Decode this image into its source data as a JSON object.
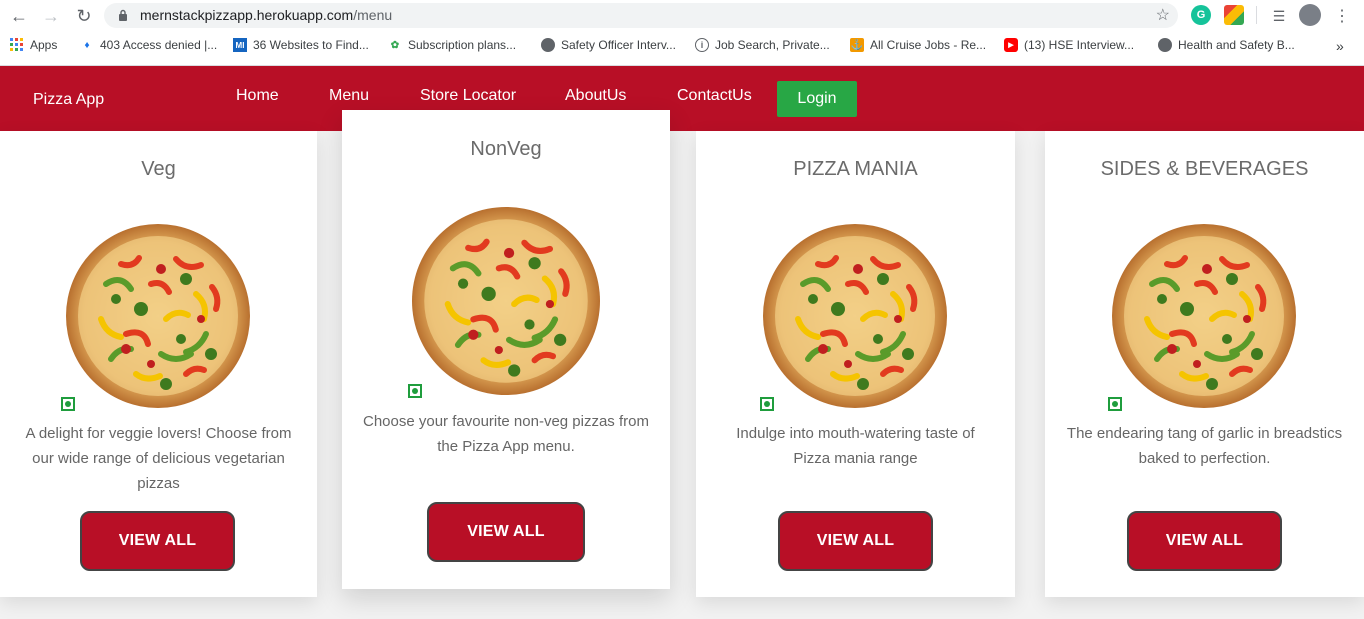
{
  "browser": {
    "url_host": "mernstackpizzapp.herokuapp.com",
    "url_path": "/menu",
    "bookmarks": [
      {
        "label": "Apps",
        "icon": "apps-grid-icon"
      },
      {
        "label": "403 Access denied |...",
        "icon": "flame-icon"
      },
      {
        "label": "36 Websites to Find...",
        "icon": "mi-logo-icon"
      },
      {
        "label": "Subscription plans...",
        "icon": "leaf-icon"
      },
      {
        "label": "Safety Officer Interv...",
        "icon": "globe-icon"
      },
      {
        "label": "Job Search, Private...",
        "icon": "info-icon"
      },
      {
        "label": "All Cruise Jobs - Re...",
        "icon": "anchor-icon"
      },
      {
        "label": "(13) HSE Interview...",
        "icon": "youtube-icon"
      },
      {
        "label": "Health and Safety B...",
        "icon": "globe-icon"
      }
    ]
  },
  "app": {
    "brand": "Pizza App",
    "nav": [
      "Home",
      "Menu",
      "Store Locator",
      "AboutUs",
      "ContactUs"
    ],
    "login_label": "Login",
    "accent": "#b80f26",
    "login_color": "#28a745"
  },
  "cards": [
    {
      "title": "Veg",
      "description": "A delight for veggie lovers! Choose from our wide range of delicious vegetarian pizzas",
      "button": "VIEW ALL"
    },
    {
      "title": "NonVeg",
      "description": "Choose your favourite non-veg pizzas from the Pizza App menu.",
      "button": "VIEW ALL"
    },
    {
      "title": "PIZZA MANIA",
      "description": "Indulge into mouth-watering taste of Pizza mania range",
      "button": "VIEW ALL"
    },
    {
      "title": "SIDES & BEVERAGES",
      "description": "The endearing tang of garlic in breadstics baked to perfection.",
      "button": "VIEW ALL"
    }
  ]
}
